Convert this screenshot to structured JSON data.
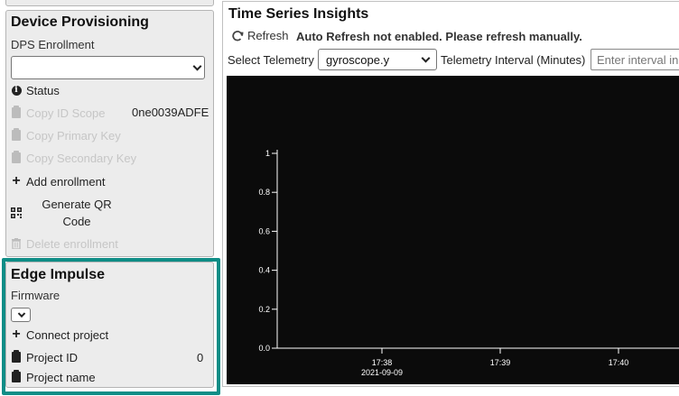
{
  "device_provisioning": {
    "title": "Device Provisioning",
    "enrollment_label": "DPS Enrollment",
    "enrollment_selected": "",
    "status_label": "Status",
    "copy_id_scope_label": "Copy ID Scope",
    "id_scope_value": "0ne0039ADFE",
    "copy_primary_key_label": "Copy Primary Key",
    "copy_secondary_key_label": "Copy Secondary Key",
    "add_enrollment_label": "Add enrollment",
    "generate_qr_label": "Generate QR Code",
    "delete_enrollment_label": "Delete enrollment"
  },
  "edge_impulse": {
    "title": "Edge Impulse",
    "firmware_label": "Firmware",
    "firmware_selected": "",
    "connect_project_label": "Connect project",
    "project_id_label": "Project ID",
    "project_id_value": "0",
    "project_name_label": "Project name",
    "highlight_color": "#0f8d86"
  },
  "insights": {
    "title": "Time Series Insights",
    "refresh_label": "Refresh",
    "auto_refresh_note": "Auto Refresh not enabled. Please refresh manually.",
    "select_telemetry_label": "Select Telemetry",
    "telemetry_selected": "gyroscope.y",
    "interval_label": "Telemetry Interval (Minutes)",
    "interval_placeholder": "Enter interval in minutes"
  },
  "chart_data": {
    "type": "line",
    "y_ticks": [
      "0.0",
      "0.2",
      "0.4",
      "0.6",
      "0.8",
      "1"
    ],
    "ylim": [
      0,
      1
    ],
    "x_ticks": [
      "17:38",
      "17:39",
      "17:40"
    ],
    "x_date_label": "2021-09-09",
    "series": [],
    "background": "#0b0b0b",
    "axis_color": "#ffffff"
  }
}
